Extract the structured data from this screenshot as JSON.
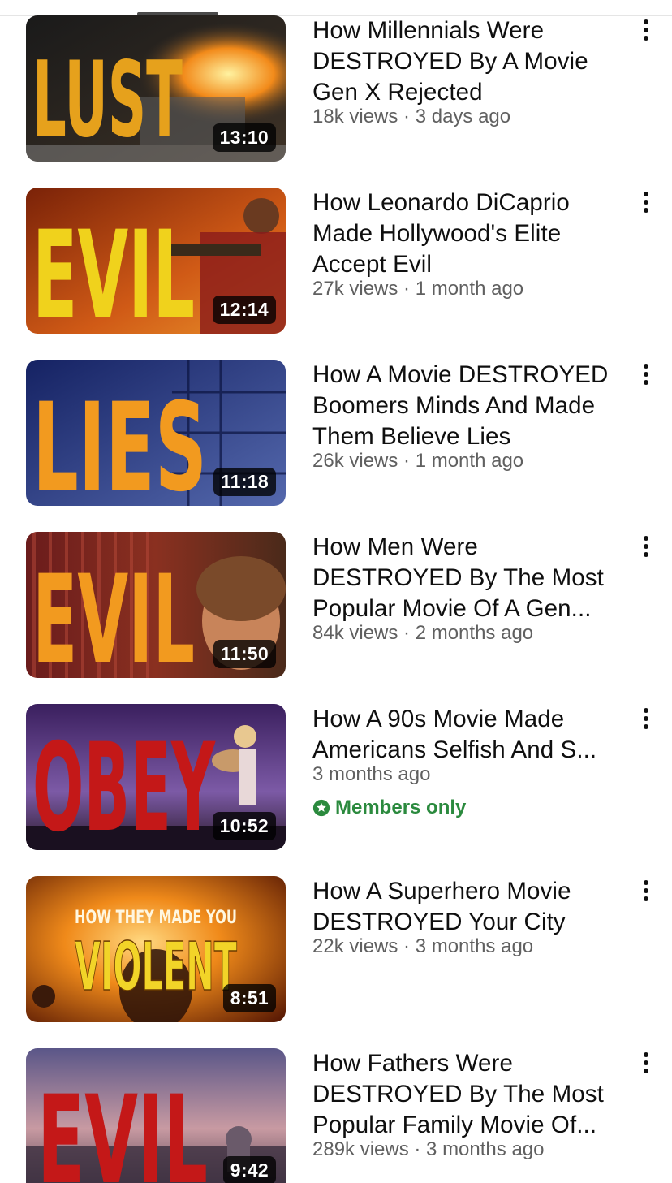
{
  "videos": [
    {
      "title": "How Millennials Were DESTROYED By A Movie Gen X Rejected",
      "meta": "18k views · 3 days ago",
      "duration": "13:10",
      "thumb_text": "LUST",
      "thumb_text_color": "#e6a11c",
      "thumb_bg": [
        "#1e1e1e",
        "#4a3a2a"
      ]
    },
    {
      "title": "How Leonardo DiCaprio Made Hollywood's Elite Accept Evil",
      "meta": "27k views · 1 month ago",
      "duration": "12:14",
      "thumb_text": "EVIL",
      "thumb_text_color": "#f0d21c",
      "thumb_bg": [
        "#8a2a0a",
        "#d9661a"
      ]
    },
    {
      "title": "How A Movie DESTROYED Boomers Minds And Made Them Believe Lies",
      "meta": "26k views · 1 month ago",
      "duration": "11:18",
      "thumb_text": "LIES",
      "thumb_text_color": "#f29a1f",
      "thumb_bg": [
        "#1b2b6b",
        "#4d5fa8"
      ]
    },
    {
      "title": "How Men Were DESTROYED By The Most Popular Movie Of A Gen...",
      "meta": "84k views · 2 months ago",
      "duration": "11:50",
      "thumb_text": "EVIL",
      "thumb_text_color": "#f29a1f",
      "thumb_bg": [
        "#5a1a1a",
        "#a4472e"
      ]
    },
    {
      "title": "How A 90s Movie Made Americans Selfish And S...",
      "meta": "3 months ago",
      "badge": "Members only",
      "duration": "10:52",
      "thumb_text": "OBEY",
      "thumb_text_color": "#c41818",
      "thumb_bg": [
        "#3a1d5a",
        "#7d5aa8"
      ]
    },
    {
      "title": "How A Superhero Movie DESTROYED Your City",
      "meta": "22k views · 3 months ago",
      "duration": "8:51",
      "thumb_caption": "HOW THEY MADE YOU",
      "thumb_text": "VIOLENT",
      "thumb_text_color": "#f2d428",
      "thumb_bg": [
        "#6a2a08",
        "#f08a1a"
      ]
    },
    {
      "title": "How Fathers Were DESTROYED By The Most Popular Family Movie Of...",
      "meta": "289k views · 3 months ago",
      "duration": "9:42",
      "thumb_text": "EVIL",
      "thumb_text_color": "#c41818",
      "thumb_bg": [
        "#5e5a8a",
        "#c79aa0"
      ]
    }
  ],
  "icons": {
    "more": "more-vert-icon",
    "members": "star-badge-icon"
  }
}
